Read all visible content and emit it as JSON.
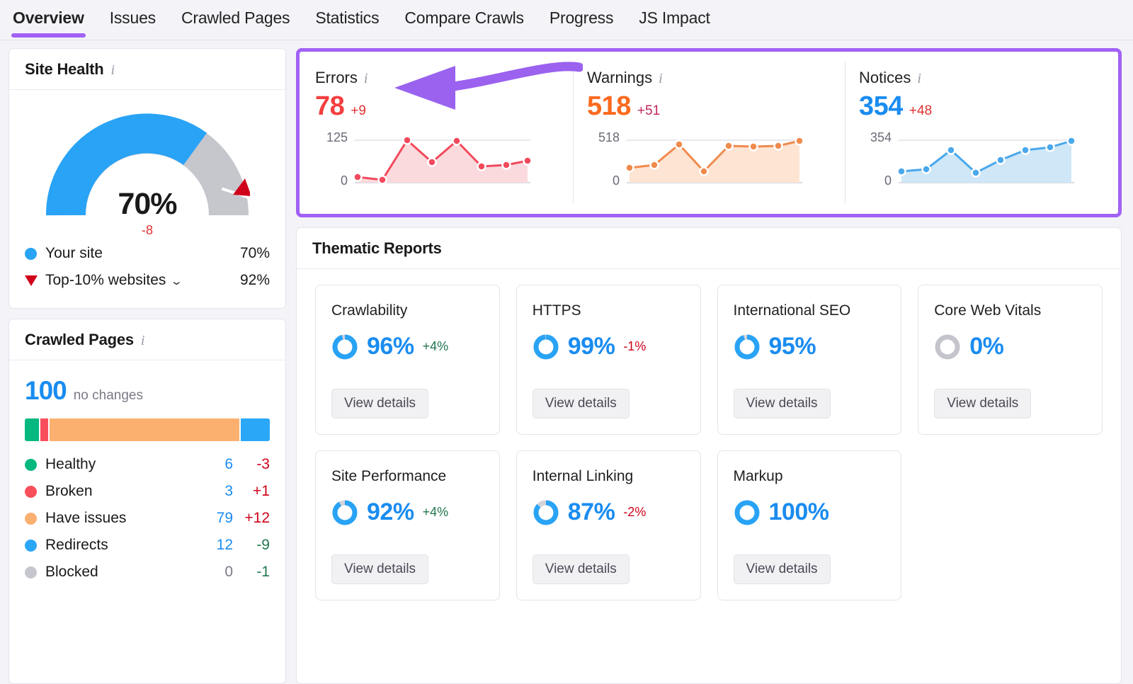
{
  "tabs": [
    {
      "label": "Overview",
      "active": true
    },
    {
      "label": "Issues",
      "active": false
    },
    {
      "label": "Crawled Pages",
      "active": false
    },
    {
      "label": "Statistics",
      "active": false
    },
    {
      "label": "Compare Crawls",
      "active": false
    },
    {
      "label": "Progress",
      "active": false
    },
    {
      "label": "JS Impact",
      "active": false
    }
  ],
  "site_health": {
    "title": "Site Health",
    "info_icon": "info-icon",
    "score": "70%",
    "delta": "-8",
    "legend": [
      {
        "label": "Your site",
        "value": "70%",
        "marker": "dot",
        "color": "#29a3f5"
      },
      {
        "label": "Top-10% websites",
        "value": "92%",
        "marker": "triangle",
        "color": "#d0021b",
        "chevron": "⌄"
      }
    ]
  },
  "crawled_pages": {
    "title": "Crawled Pages",
    "info_icon": "info-icon",
    "total": "100",
    "total_note": "no changes",
    "rows": [
      {
        "label": "Healthy",
        "count": "6",
        "delta": "-3",
        "color": "#04b87f",
        "share": 6,
        "delta_dir": "neg"
      },
      {
        "label": "Broken",
        "count": "3",
        "delta": "+1",
        "color": "#f94f5c",
        "share": 3,
        "delta_dir": "neg"
      },
      {
        "label": "Have issues",
        "count": "79",
        "delta": "+12",
        "color": "#fcb070",
        "share": 79,
        "delta_dir": "neg"
      },
      {
        "label": "Redirects",
        "count": "12",
        "delta": "-9",
        "color": "#2ba7f7",
        "share": 12,
        "delta_dir": "pos"
      },
      {
        "label": "Blocked",
        "count": "0",
        "delta": "-1",
        "color": "#c6c6cf",
        "share": 0,
        "delta_dir": "pos"
      }
    ]
  },
  "metrics": [
    {
      "name": "Errors",
      "value": "78",
      "delta": "+9",
      "value_color": "#f43f3f",
      "delta_color": "#e03131",
      "axis_max": "125",
      "axis_min": "0",
      "line_color": "#f2495c",
      "fill_color": "#fbdadd"
    },
    {
      "name": "Warnings",
      "value": "518",
      "delta": "+51",
      "value_color": "#fa6a1e",
      "delta_color": "#c2255c",
      "axis_max": "518",
      "axis_min": "0",
      "line_color": "#f08b4e",
      "fill_color": "#fde4d3"
    },
    {
      "name": "Notices",
      "value": "354",
      "delta": "+48",
      "value_color": "#1a8cf0",
      "delta_color": "#e03131",
      "axis_max": "354",
      "axis_min": "0",
      "line_color": "#4aa8ec",
      "fill_color": "#cfe7f7"
    }
  ],
  "thematic_reports": {
    "title": "Thematic Reports",
    "button_label": "View details",
    "items": [
      {
        "name": "Crawlability",
        "pct": "96%",
        "value": 96,
        "delta": "+4%",
        "delta_dir": "pos"
      },
      {
        "name": "HTTPS",
        "pct": "99%",
        "value": 99,
        "delta": "-1%",
        "delta_dir": "neg"
      },
      {
        "name": "International SEO",
        "pct": "95%",
        "value": 95,
        "delta": "",
        "delta_dir": ""
      },
      {
        "name": "Core Web Vitals",
        "pct": "0%",
        "value": 0,
        "delta": "",
        "delta_dir": ""
      },
      {
        "name": "Site Performance",
        "pct": "92%",
        "value": 92,
        "delta": "+4%",
        "delta_dir": "pos"
      },
      {
        "name": "Internal Linking",
        "pct": "87%",
        "value": 87,
        "delta": "-2%",
        "delta_dir": "neg"
      },
      {
        "name": "Markup",
        "pct": "100%",
        "value": 100,
        "delta": "",
        "delta_dir": ""
      }
    ]
  },
  "chart_data": [
    {
      "type": "area",
      "title": "Errors",
      "x": [
        1,
        2,
        3,
        4,
        5,
        6,
        7,
        8
      ],
      "values": [
        14,
        8,
        125,
        60,
        124,
        48,
        52,
        60
      ],
      "ylim": [
        0,
        125
      ],
      "ylabel": "",
      "xlabel": "",
      "grid": true,
      "legend": "none",
      "series_color": "#f2495c"
    },
    {
      "type": "area",
      "title": "Warnings",
      "x": [
        1,
        2,
        3,
        4,
        5,
        6,
        7,
        8
      ],
      "values": [
        160,
        190,
        420,
        100,
        400,
        390,
        400,
        460
      ],
      "ylim": [
        0,
        518
      ],
      "ylabel": "",
      "xlabel": "",
      "grid": true,
      "legend": "none",
      "series_color": "#f08b4e"
    },
    {
      "type": "area",
      "title": "Notices",
      "x": [
        1,
        2,
        3,
        4,
        5,
        6,
        7,
        8
      ],
      "values": [
        95,
        105,
        250,
        90,
        185,
        250,
        265,
        310
      ],
      "ylim": [
        0,
        354
      ],
      "ylabel": "",
      "xlabel": "",
      "grid": true,
      "legend": "none",
      "series_color": "#4aa8ec"
    },
    {
      "type": "pie",
      "title": "Crawled Pages",
      "categories": [
        "Healthy",
        "Broken",
        "Have issues",
        "Redirects",
        "Blocked"
      ],
      "values": [
        6,
        3,
        79,
        12,
        0
      ],
      "total": 100
    },
    {
      "type": "bar",
      "title": "Site Health",
      "categories": [
        "Your site",
        "Top-10% websites"
      ],
      "values": [
        70,
        92
      ],
      "ylim": [
        0,
        100
      ]
    }
  ],
  "annotation": {
    "type": "curved-arrow-left",
    "color": "#9a62ef",
    "points_to": "Errors"
  }
}
